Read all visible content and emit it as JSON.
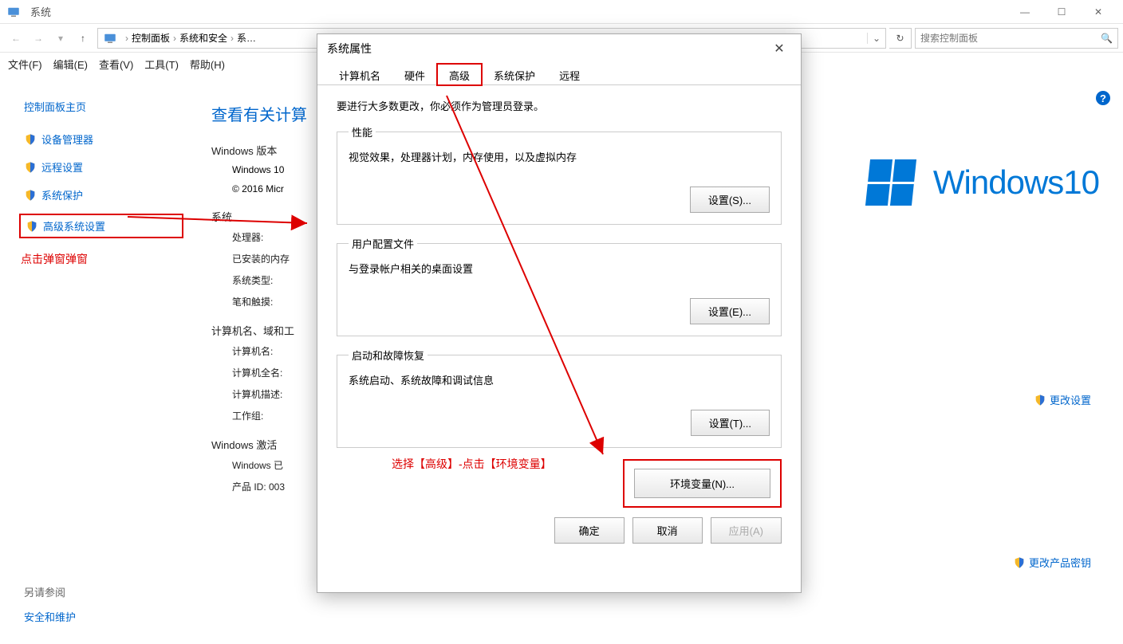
{
  "window": {
    "title": "系统"
  },
  "win_controls": {
    "min": "—",
    "max": "☐",
    "close": "✕"
  },
  "breadcrumb": {
    "items": [
      "控制面板",
      "系统和安全",
      "系…"
    ]
  },
  "refresh": "↻",
  "search": {
    "placeholder": "搜索控制面板"
  },
  "menu": {
    "file": "文件(F)",
    "edit": "编辑(E)",
    "view": "查看(V)",
    "tools": "工具(T)",
    "help": "帮助(H)"
  },
  "sidebar": {
    "title": "控制面板主页",
    "items": [
      "设备管理器",
      "远程设置",
      "系统保护",
      "高级系统设置"
    ],
    "annot": "点击弹窗弹窗"
  },
  "content": {
    "heading": "查看有关计算",
    "win_version_h": "Windows 版本",
    "win_version_line1": "Windows 10",
    "win_version_line2": "© 2016 Micr",
    "system_h": "系统",
    "system_rows": {
      "cpu": "处理器:",
      "ram": "已安装的内存",
      "type": "系统类型:",
      "pen": "笔和触摸:"
    },
    "domain_h": "计算机名、域和工",
    "domain_rows": {
      "name": "计算机名:",
      "full": "计算机全名:",
      "desc": "计算机描述:",
      "wg": "工作组:"
    },
    "act_h": "Windows 激活",
    "act_rows": {
      "act": "Windows 已",
      "pid": "产品 ID: 003"
    }
  },
  "rightlink": "更改设置",
  "rightlink2": "更改产品密钥",
  "winbrand": "Windows10",
  "seealso": {
    "label": "另请参阅",
    "link": "安全和维护"
  },
  "dialog": {
    "title": "系统属性",
    "close": "✕",
    "tabs": [
      "计算机名",
      "硬件",
      "高级",
      "系统保护",
      "远程"
    ],
    "note": "要进行大多数更改，你必须作为管理员登录。",
    "perf": {
      "legend": "性能",
      "desc": "视觉效果，处理器计划，内存使用，以及虚拟内存",
      "btn": "设置(S)..."
    },
    "prof": {
      "legend": "用户配置文件",
      "desc": "与登录帐户相关的桌面设置",
      "btn": "设置(E)..."
    },
    "boot": {
      "legend": "启动和故障恢复",
      "desc": "系统启动、系统故障和调试信息",
      "btn": "设置(T)..."
    },
    "env_btn": "环境变量(N)...",
    "ok": "确定",
    "cancel": "取消",
    "apply": "应用(A)"
  },
  "annot2": "选择【高级】-点击【环境变量】"
}
